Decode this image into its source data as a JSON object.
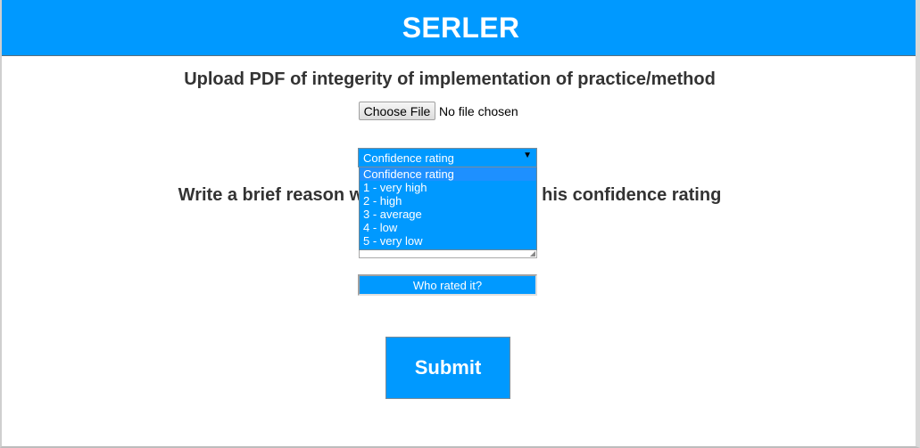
{
  "header": {
    "title": "SERLER"
  },
  "upload": {
    "heading": "Upload PDF of integerity of implementation of practice/method",
    "choose_file_label": "Choose File",
    "file_status": "No file chosen"
  },
  "confidence": {
    "selected_value": "Confidence rating",
    "options": [
      "Confidence rating",
      "1 - very high",
      "2 - high",
      "3 - average",
      "4 - low",
      "5 - very low"
    ]
  },
  "reason": {
    "heading_left": "Write a brief reason w",
    "heading_right": "his confidence rating"
  },
  "rater": {
    "placeholder": "Who rated it?"
  },
  "submit": {
    "label": "Submit"
  },
  "colors": {
    "accent": "#0099ff",
    "heading_text": "#333333"
  },
  "icons": {
    "select_arrow": "triangle-down-icon",
    "resize_grip": "resize-grip-icon"
  }
}
